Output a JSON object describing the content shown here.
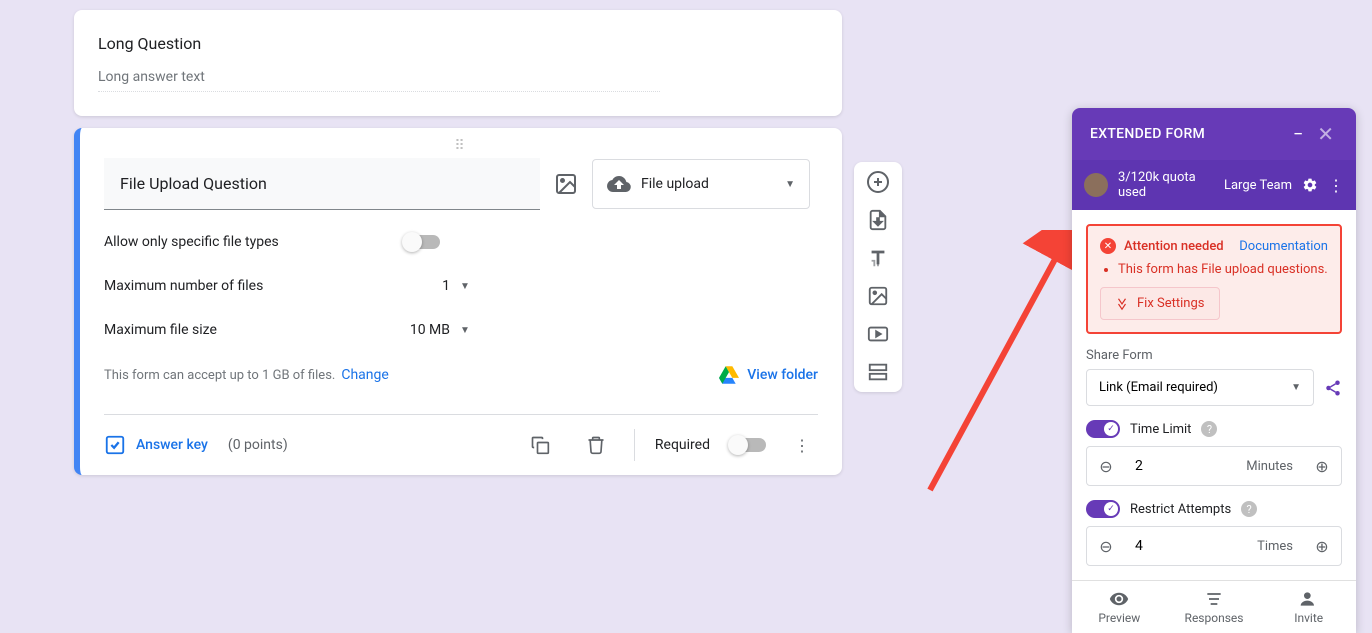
{
  "longQuestion": {
    "title": "Long Question",
    "placeholder": "Long answer text"
  },
  "fileQuestion": {
    "title": "File Upload Question",
    "typeLabel": "File upload",
    "allowTypes": {
      "label": "Allow only specific file types",
      "on": false
    },
    "maxFiles": {
      "label": "Maximum number of files",
      "value": "1"
    },
    "maxSize": {
      "label": "Maximum file size",
      "value": "10 MB"
    },
    "limitText": "This form can accept up to 1 GB of files.",
    "changeLabel": "Change",
    "viewFolder": "View folder",
    "answerKey": "Answer key",
    "points": "(0 points)",
    "requiredLabel": "Required"
  },
  "panel": {
    "title": "EXTENDED FORM",
    "quota": "3/120k quota used",
    "team": "Large Team",
    "alert": {
      "title": "Attention needed",
      "docLink": "Documentation",
      "items": [
        "This form has File upload questions."
      ],
      "fixLabel": "Fix Settings"
    },
    "shareLabel": "Share Form",
    "shareValue": "Link (Email required)",
    "timeLimit": {
      "label": "Time Limit",
      "value": "2",
      "unit": "Minutes"
    },
    "restrict": {
      "label": "Restrict Attempts",
      "value": "4",
      "unit": "Times"
    },
    "tabs": {
      "preview": "Preview",
      "responses": "Responses",
      "invite": "Invite"
    }
  }
}
